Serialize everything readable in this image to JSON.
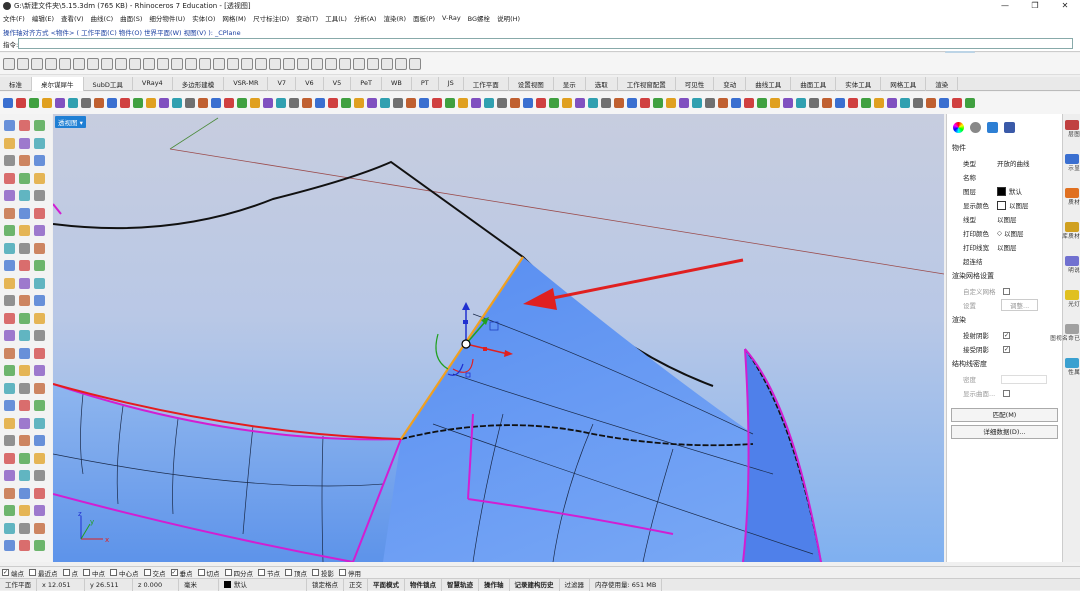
{
  "window": {
    "title": "G:\\新建文件夹\\5.15.3dm (765 KB) - Rhinoceros 7 Education - [透视图]",
    "controls": [
      "—",
      "❐",
      "✕"
    ]
  },
  "menu": [
    "文件(F)",
    "编辑(E)",
    "查看(V)",
    "曲线(C)",
    "曲面(S)",
    "细分物件(U)",
    "实体(O)",
    "网格(M)",
    "尺寸标注(D)",
    "变动(T)",
    "工具(L)",
    "分析(A)",
    "渲染(R)",
    "面板(P)",
    "V-Ray",
    "BG螺栓",
    "说明(H)"
  ],
  "command": {
    "history": "操作轴对齐方式 <物件> ( 工作平面(C) 物件(O) 世界平面(W) 视图(V) ): _CPlane",
    "prompt": "指令:"
  },
  "tabs": [
    {
      "label": "标准",
      "active": false
    },
    {
      "label": "桌尔谋犀牛",
      "active": true
    },
    {
      "label": "SubD工具",
      "active": false
    },
    {
      "label": "VRay4",
      "active": false
    },
    {
      "label": "多边形建模",
      "active": false
    },
    {
      "label": "VSR-MR",
      "active": false
    },
    {
      "label": "V7",
      "active": false
    },
    {
      "label": "V6",
      "active": false
    },
    {
      "label": "V5",
      "active": false
    },
    {
      "label": "PeT",
      "active": false
    },
    {
      "label": "WB",
      "active": false
    },
    {
      "label": "PT",
      "active": false
    },
    {
      "label": "JS",
      "active": false
    },
    {
      "label": "工作平面",
      "active": false
    },
    {
      "label": "设置视图",
      "active": false
    },
    {
      "label": "显示",
      "active": false
    },
    {
      "label": "选取",
      "active": false
    },
    {
      "label": "工作视窗配置",
      "active": false
    },
    {
      "label": "可见性",
      "active": false
    },
    {
      "label": "变动",
      "active": false
    },
    {
      "label": "曲线工具",
      "active": false
    },
    {
      "label": "曲面工具",
      "active": false
    },
    {
      "label": "实体工具",
      "active": false
    },
    {
      "label": "网格工具",
      "active": false
    },
    {
      "label": "渲染",
      "active": false
    }
  ],
  "viewport": {
    "label": "透视图 ▾",
    "axes": {
      "x": "x",
      "y": "y",
      "z": "z"
    }
  },
  "properties": {
    "section_object": "物件",
    "rows": [
      {
        "k": "类型",
        "v": "开放的曲线"
      },
      {
        "k": "名称",
        "v": ""
      },
      {
        "k": "图层",
        "v": "默认",
        "swatch": "#000000"
      },
      {
        "k": "显示颜色",
        "v": "以图层",
        "swatch": "#ffffff"
      },
      {
        "k": "线型",
        "v": "以图层"
      },
      {
        "k": "打印颜色",
        "v": "以图层",
        "diamond": true
      },
      {
        "k": "打印线宽",
        "v": "以图层"
      },
      {
        "k": "超连结",
        "v": ""
      }
    ],
    "section_mesh": "渲染网格设置",
    "mesh_custom": "自定义网格",
    "mesh_settings": "设置",
    "mesh_adjust": "调整...",
    "section_render": "渲染",
    "cast_shadows": "投射阴影",
    "receive_shadows": "接受阴影",
    "section_isocurve": "结构线密度",
    "density": "密度",
    "show_surface": "显示曲面...",
    "match_button": "匹配(M)",
    "details_button": "详细数据(D)..."
  },
  "side_tabs": [
    "图层",
    "显示",
    "材质",
    "材质库",
    "说明",
    "灯光",
    "已命名视图",
    "属性"
  ],
  "osnaps": [
    {
      "label": "端点",
      "checked": true
    },
    {
      "label": "最近点",
      "checked": false
    },
    {
      "label": "点",
      "checked": false
    },
    {
      "label": "中点",
      "checked": false
    },
    {
      "label": "中心点",
      "checked": false
    },
    {
      "label": "交点",
      "checked": false
    },
    {
      "label": "垂点",
      "checked": true
    },
    {
      "label": "切点",
      "checked": false
    },
    {
      "label": "四分点",
      "checked": false
    },
    {
      "label": "节点",
      "checked": false
    },
    {
      "label": "顶点",
      "checked": false
    },
    {
      "label": "投影",
      "checked": false
    },
    {
      "label": "停用",
      "checked": false
    }
  ],
  "status": {
    "cplane": "工作平面",
    "x": "x 12.051",
    "y": "y 26.511",
    "z": "z 0.000",
    "units": "毫米",
    "layer": "默认",
    "toggles": [
      "锁定格点",
      "正交",
      "平面模式",
      "物件锁点",
      "智慧轨迹",
      "操作轴",
      "记录建构历史",
      "过滤器"
    ],
    "memory": "内存使用量: 651 MB"
  },
  "colors": {
    "accent": "#1f7fd4",
    "surface": "#5a8ff0",
    "magenta": "#d21ed2",
    "red_arrow": "#e02020"
  }
}
